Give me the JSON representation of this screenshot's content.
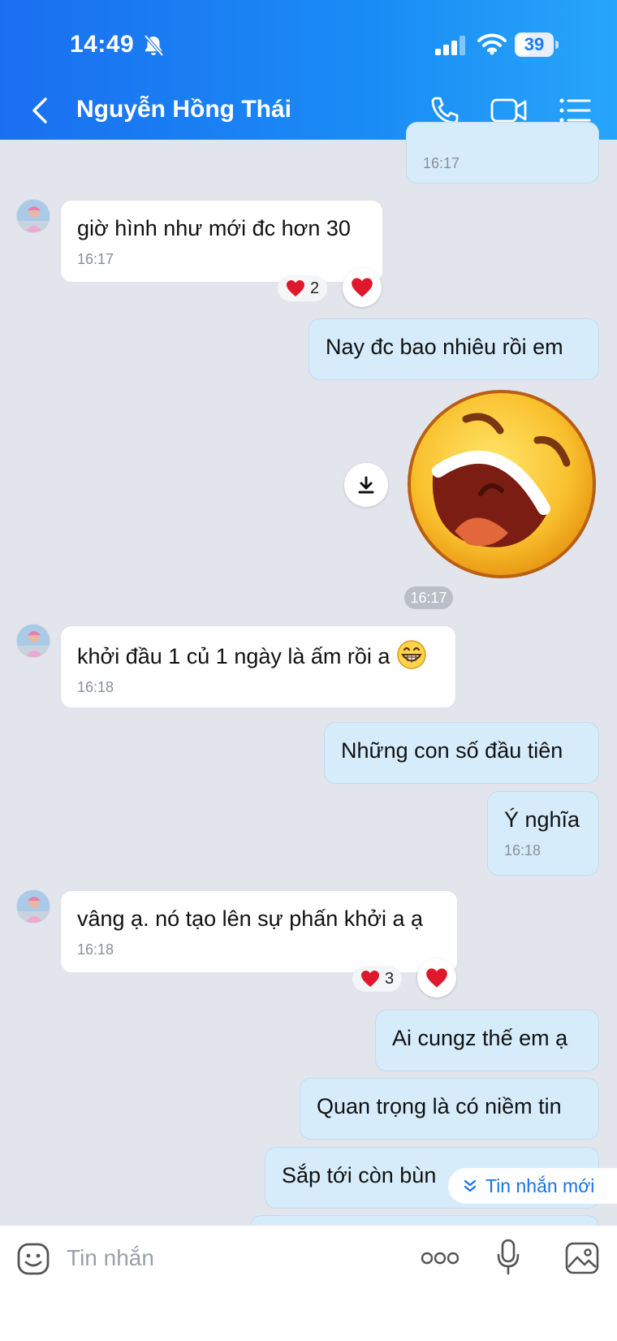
{
  "status_bar": {
    "time": "14:49",
    "battery": "39",
    "battery_level": 0.39
  },
  "header": {
    "contact_name": "Nguyễn Hồng Thái"
  },
  "messages": [
    {
      "id": "m0",
      "time": "16:17"
    },
    {
      "id": "m1",
      "text": "giờ hình như mới đc hơn 30",
      "time": "16:17",
      "reaction_count": "2"
    },
    {
      "id": "m2",
      "text": "Nay đc bao nhiêu rồi em"
    },
    {
      "id": "m3",
      "sticker": "laughing-face-sticker",
      "time": "16:17"
    },
    {
      "id": "m4",
      "text": "khởi đầu 1 củ 1 ngày là ấm rồi a",
      "emoji": "grinning-face",
      "time": "16:18"
    },
    {
      "id": "m5",
      "text": "Những con số đầu tiên"
    },
    {
      "id": "m6",
      "text": "Ý nghĩa",
      "time": "16:18"
    },
    {
      "id": "m7",
      "text": "vâng ạ. nó tạo lên sự phấn khởi a ạ",
      "time": "16:18",
      "reaction_count": "3"
    },
    {
      "id": "m8",
      "text": "Ai cungz thế em ạ"
    },
    {
      "id": "m9",
      "text": "Quan trọng là có niềm tin"
    },
    {
      "id": "m10",
      "text": "Sắp tới còn bùn"
    }
  ],
  "new_messages_label": "Tin nhắn mới",
  "composer": {
    "placeholder": "Tin nhắn"
  },
  "colors": {
    "header_start": "#1a6ff0",
    "header_end": "#27a5fa",
    "outgoing_bubble": "#d6ecfb",
    "incoming_bubble": "#ffffff",
    "background": "#e2e5ec",
    "heart": "#e0182b",
    "link": "#1a73e8"
  }
}
